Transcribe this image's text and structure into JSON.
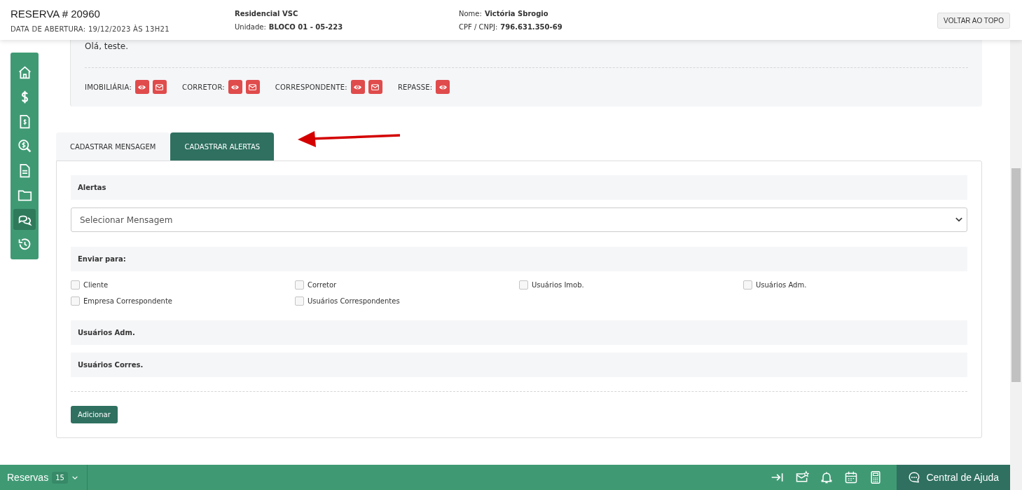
{
  "header": {
    "title": "RESERVA # 20960",
    "opened": "DATA DE ABERTURA: 19/12/2023 ÀS 13H21",
    "project": "Residencial VSC",
    "unit_label": "Unidade:",
    "unit": "BLOCO 01 - 05-223",
    "name_label": "Nome:",
    "name": "Victória Sbrogio",
    "doc_label": "CPF / CNPJ:",
    "doc": "796.631.350-69",
    "top_button": "VOLTAR AO TOPO"
  },
  "sidebar": {
    "items": [
      {
        "kind": "home",
        "selected": false
      },
      {
        "kind": "dollar",
        "selected": false
      },
      {
        "kind": "invoice",
        "selected": false
      },
      {
        "kind": "search-money",
        "selected": false
      },
      {
        "kind": "document",
        "selected": false
      },
      {
        "kind": "folder",
        "selected": false
      },
      {
        "kind": "chat",
        "selected": true
      },
      {
        "kind": "history",
        "selected": false
      }
    ]
  },
  "message": {
    "text": "Olá, teste.",
    "recipients": [
      {
        "label": "IMOBILIÁRIA:",
        "actions": [
          {
            "kind": "view"
          },
          {
            "kind": "email"
          }
        ]
      },
      {
        "label": "CORRETOR:",
        "actions": [
          {
            "kind": "view"
          },
          {
            "kind": "email"
          }
        ]
      },
      {
        "label": "CORRESPONDENTE:",
        "actions": [
          {
            "kind": "view"
          },
          {
            "kind": "email"
          }
        ]
      },
      {
        "label": "REPASSE:",
        "actions": [
          {
            "kind": "view"
          }
        ]
      }
    ]
  },
  "tabs": [
    {
      "label": "CADASTRAR MENSAGEM",
      "selected": false
    },
    {
      "label": "CADASTRAR ALERTAS",
      "selected": true
    }
  ],
  "form": {
    "alerts_title": "Alertas",
    "select_placeholder": "Selecionar Mensagem",
    "send_to_title": "Enviar para:",
    "checkboxes": [
      {
        "label": "Cliente",
        "checked": false
      },
      {
        "label": "Corretor",
        "checked": false
      },
      {
        "label": "Usuários Imob.",
        "checked": false
      },
      {
        "label": "Usuários Adm.",
        "checked": false
      },
      {
        "label": "Empresa Correspondente",
        "checked": false
      },
      {
        "label": "Usuários Correspondentes",
        "checked": false
      }
    ],
    "sections": [
      "Usuários Adm.",
      "Usuários Corres."
    ],
    "submit": "Adicionar"
  },
  "footer": {
    "reservas": "Reservas",
    "count": "15",
    "tools": [
      {
        "kind": "collapse"
      },
      {
        "kind": "mail-star"
      },
      {
        "kind": "bell"
      },
      {
        "kind": "calendar"
      },
      {
        "kind": "calculator"
      }
    ],
    "help": "Central de Ajuda"
  }
}
